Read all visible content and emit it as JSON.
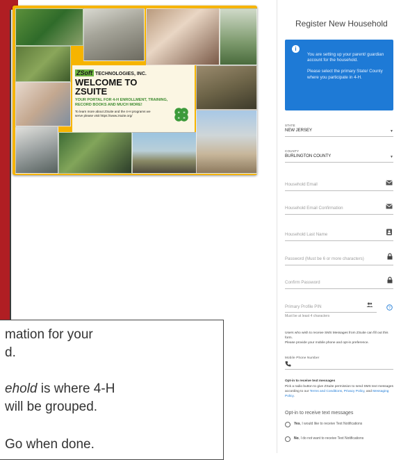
{
  "banner": {
    "logo_mark": "ZSoft",
    "logo_text": "TECHNOLOGIES, INC.",
    "title_line1": "WELCOME TO",
    "title_line2": "ZSUITE",
    "subtitle": "YOUR PORTAL FOR 4-H ENROLLMENT, TRAINING, RECORD BOOKS AND MUCH MORE!",
    "small_text": "To learn more about ZSuite and the 4-H programs we serve please visit https://www.zsuite.org/"
  },
  "tooltip": {
    "line1": "mation for your",
    "line2": "d.",
    "line3_italic": "ehold",
    "line3_rest": " is where 4-H",
    "line4": "will be grouped.",
    "line5": "Go when done."
  },
  "panel": {
    "title": "Register New Household",
    "info_text": "You are setting up your parent/ guardian account for the household.",
    "info_text2": "Please select the primary State/ County where you participate in 4-H.",
    "state_label": "STATE",
    "state_value": "NEW JERSEY",
    "county_label": "COUNTY",
    "county_value": "BURLINGTON COUNTY",
    "email_placeholder": "Household Email",
    "email_confirm_placeholder": "Household Email Confirmation",
    "last_name_placeholder": "Household Last Name",
    "password_placeholder": "Password (Must be 6 or more characters)",
    "confirm_password_placeholder": "Confirm Password",
    "pin_placeholder": "Primary Profile PIN",
    "pin_helper": "Must be at least 4 characters",
    "sms_text": "Users who wish to receive SMS Messages from ZSuite can fill out this form.",
    "sms_text2": "Please provide your mobile phone and opt-in preference.",
    "mobile_label": "Mobile Phone Number",
    "opt_title": "Opt-in to receive text messages",
    "opt_text_a": "Pick a radio button to give ZSuite permission to send SMS text messages according to our ",
    "terms_link": "Terms and Conditions",
    "opt_text_b": ", ",
    "privacy_link": "Privacy Policy",
    "opt_text_c": ", and ",
    "messaging_link": "Messaging Policy",
    "opt_text_d": ".",
    "opt_heading": "Opt-in to receive text messages",
    "yes_bold": "Yes",
    "yes_rest": ", I would like to receive Text Notifications",
    "no_bold": "No",
    "no_rest": ", I do not want to receive Text Notifications"
  },
  "colors": {
    "accent_blue": "#1e7ad6",
    "banner_yellow": "#f6b400",
    "red_panel": "#b01e23",
    "clover_green": "#3c9a3a"
  }
}
